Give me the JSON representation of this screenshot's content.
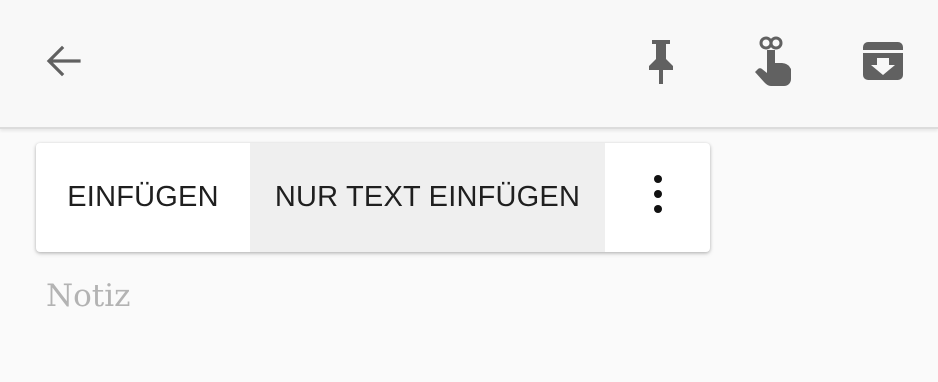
{
  "toolbar": {
    "back_icon": "arrow-left-icon",
    "pin_icon": "pin-icon",
    "reminder_icon": "reminder-finger-icon",
    "archive_icon": "archive-icon",
    "icon_color": "#616161"
  },
  "context_menu": {
    "paste_label": "EINFÜGEN",
    "paste_plain_label": "NUR TEXT EINFÜGEN",
    "more_icon": "more-vertical-icon"
  },
  "note": {
    "placeholder": "Notiz"
  }
}
